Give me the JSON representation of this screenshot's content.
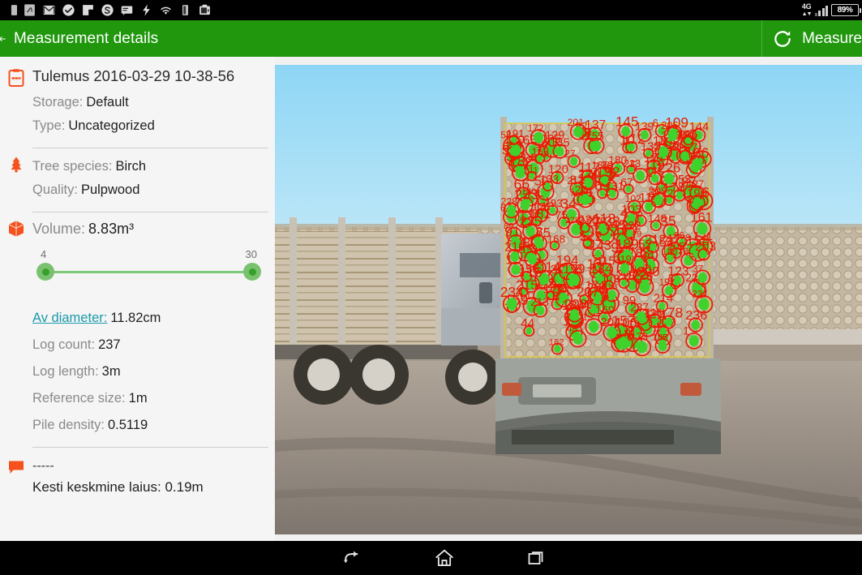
{
  "statusbar": {
    "icons": [
      {
        "name": "app-icon-partial"
      },
      {
        "name": "signature-app-icon"
      },
      {
        "name": "gmail-icon"
      },
      {
        "name": "checkmark-circle-icon"
      },
      {
        "name": "flag-icon"
      },
      {
        "name": "skype-icon"
      },
      {
        "name": "message-icon"
      },
      {
        "name": "flash-icon"
      },
      {
        "name": "wifi-icon"
      },
      {
        "name": "usb-icon"
      },
      {
        "name": "screenshot-icon"
      }
    ],
    "network_label": "4G",
    "battery_percent": "89%"
  },
  "appbar": {
    "back_label": "back",
    "title": "Measurement details",
    "action_label": "Measure",
    "action_icon": "refresh-icon",
    "background_color": "#20970d"
  },
  "sidebar": {
    "identity": {
      "icon": "clipboard-icon",
      "title": "Tulemus 2016-03-29 10-38-56",
      "rows": [
        {
          "label": "Storage:",
          "value": "Default"
        },
        {
          "label": "Type:",
          "value": "Uncategorized"
        }
      ]
    },
    "tree": {
      "icon": "tree-icon",
      "rows": [
        {
          "label": "Tree species:",
          "value": "Birch"
        },
        {
          "label": "Quality:",
          "value": "Pulpwood"
        }
      ]
    },
    "volume": {
      "icon": "box-icon",
      "label": "Volume:",
      "value": "8.83m³",
      "slider": {
        "min_label": "4",
        "max_label": "30",
        "track_color": "#7ec97a",
        "thumb_color": "#37a02a"
      }
    },
    "stats": [
      {
        "label": "Av diameter:",
        "value": "11.82cm",
        "is_link": true
      },
      {
        "label": "Log count:",
        "value": "237",
        "is_link": false
      },
      {
        "label": "Log length:",
        "value": "3m",
        "is_link": false
      },
      {
        "label": "Reference size:",
        "value": "1m",
        "is_link": false
      },
      {
        "label": "Pile density:",
        "value": "0.5119",
        "is_link": false
      }
    ],
    "comment": {
      "icon": "comment-icon",
      "dashes": "-----",
      "text": "Kesti keskmine laius: 0.19m"
    }
  },
  "photo": {
    "name": "measurement-photo",
    "description": "Logging truck loaded with birch pulpwood logs, log detection overlay",
    "overlay": {
      "circle_color": "#e81b00",
      "fill_color": "#3fd22a",
      "box_color": "#d8c84a",
      "detected_count": "237"
    }
  },
  "navbar": {
    "buttons": [
      {
        "name": "nav-back",
        "icon": "back-arrow-icon"
      },
      {
        "name": "nav-home",
        "icon": "home-icon"
      },
      {
        "name": "nav-recents",
        "icon": "recents-icon"
      }
    ]
  }
}
